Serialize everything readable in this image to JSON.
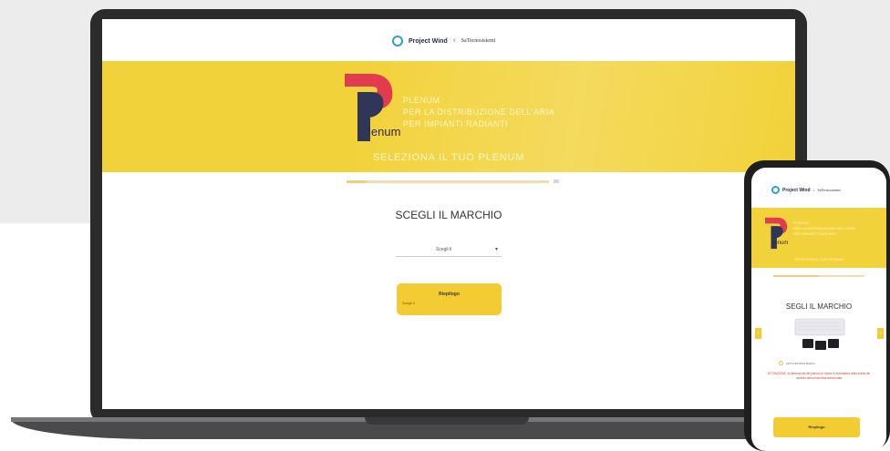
{
  "colors": {
    "brand_yellow": "#f2d23a",
    "button_yellow": "#f3cb32",
    "plenum_red": "#e23a4e",
    "plenum_navy": "#2f3657",
    "project_wind_blue": "#2f9fd0",
    "warning_red": "#e03a2a"
  },
  "header": {
    "logo_icon": "project-wind-logo-icon",
    "brand_name": "Project Wind",
    "separator": "x",
    "partner_name": "SaTecnosistemi"
  },
  "hero": {
    "logo_icon": "plenum-logo-icon",
    "logo_text": "lenum",
    "lines": [
      "PLENUM",
      "PER LA DISTRIBUZIONE DELL'ARIA",
      "PER IMPIANTI RADIANTI"
    ],
    "cta": "SELEZIONA IL TUO PLENUM"
  },
  "progress": {
    "value_fraction": 0.1
  },
  "step": {
    "title": "SCEGLI IL MARCHIO"
  },
  "brand_select": {
    "value": "Scegli il",
    "icon": "chevron-down-icon"
  },
  "next_button": {
    "label": "Riepilogo",
    "sublabel": "Scegli il"
  },
  "mobile": {
    "header": {
      "brand_name": "Project Wind",
      "separator": "x",
      "partner_name": "SaTecnosistemi"
    },
    "hero": {
      "logo_text": "lenum",
      "lines": [
        "PLENUM",
        "PER LA DISTRIBUZIONE DELL'ARIA",
        "PER IMPIANTI RADIANTI"
      ],
      "cta": "SELEZIONA IL TUO PLENUM"
    },
    "progress": {
      "value_fraction": 0.5
    },
    "step": {
      "title": "SEGLI IL MARCHIO"
    },
    "prev_icon": "chevron-left-icon",
    "next_icon": "chevron-right-icon",
    "option_label": "ioPT 2.3/2.5/3.0 R-ECO",
    "warning": "ATTENZIONE: la dimensione del plenum si ricava in automatico dalla scelta del modello della macchina selezionata",
    "next_button": {
      "label": "Riepilogo"
    }
  }
}
